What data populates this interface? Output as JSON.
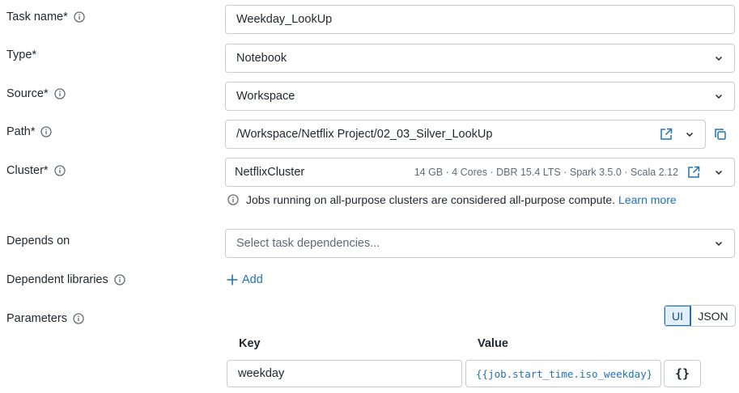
{
  "task_name": {
    "label": "Task name*",
    "value": "Weekday_LookUp"
  },
  "type": {
    "label": "Type*",
    "value": "Notebook"
  },
  "source": {
    "label": "Source*",
    "value": "Workspace"
  },
  "path": {
    "label": "Path*",
    "value": "/Workspace/Netflix Project/02_03_Silver_LookUp"
  },
  "cluster": {
    "label": "Cluster*",
    "name": "NetflixCluster",
    "details": "14 GB · 4 Cores · DBR 15.4 LTS · Spark 3.5.0 · Scala 2.12",
    "note": "Jobs running on all-purpose clusters are considered all-purpose compute.",
    "learn_more": "Learn more"
  },
  "depends_on": {
    "label": "Depends on",
    "placeholder": "Select task dependencies..."
  },
  "dependent_libraries": {
    "label": "Dependent libraries",
    "add_label": "Add"
  },
  "parameters": {
    "label": "Parameters",
    "toggle": {
      "ui": "UI",
      "json": "JSON",
      "selected": "UI"
    },
    "key_header": "Key",
    "value_header": "Value",
    "rows": [
      {
        "key": "weekday",
        "value": "{{job.start_time.iso_weekday}}"
      }
    ],
    "braces_label": "{}"
  },
  "colors": {
    "link": "#2272b4",
    "border": "#c7cdd3",
    "text": "#1f272d",
    "muted": "#5f6b76"
  }
}
